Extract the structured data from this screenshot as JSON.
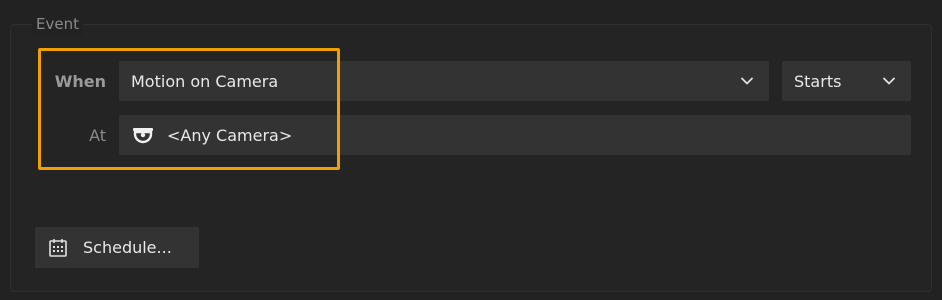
{
  "event_section": {
    "legend": "Event"
  },
  "when_row": {
    "label": "When",
    "event_type": "Motion on Camera",
    "event_state": "Starts"
  },
  "at_row": {
    "label": "At",
    "camera": "<Any Camera>"
  },
  "schedule_button": {
    "label": "Schedule..."
  },
  "icons": {
    "camera": "dome-camera-icon",
    "schedule": "calendar-icon",
    "dropdown": "chevron-down-icon"
  },
  "colors": {
    "background": "#222222",
    "control": "#333333",
    "highlight": "#f0a000",
    "text": "#e8e8e8"
  }
}
